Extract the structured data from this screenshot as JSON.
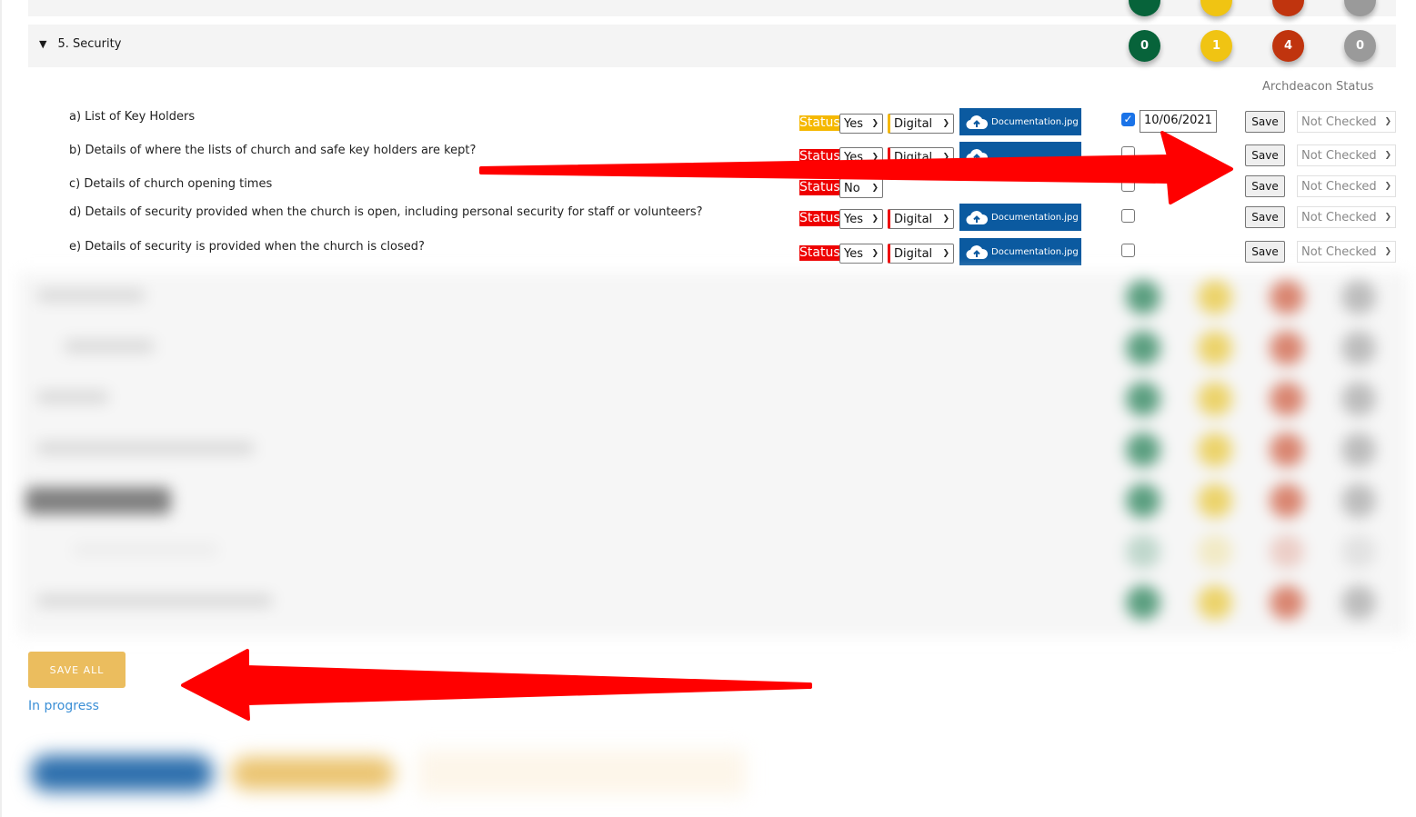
{
  "previous_section": {
    "badges": {
      "green": "",
      "yellow": "",
      "red": "",
      "grey": ""
    }
  },
  "section": {
    "caret": "▼",
    "title": "5. Security",
    "badges": {
      "green": "0",
      "yellow": "1",
      "red": "4",
      "grey": "0"
    },
    "archdeacon_header": "Archdeacon Status"
  },
  "colors": {
    "green": "#07633a",
    "yellow": "#f0c413",
    "red": "#c0340e",
    "grey": "#9a9a9a",
    "status_yellow": "#f5b800",
    "status_red": "#ee0000",
    "doc_blue": "#0b5aa0",
    "save_all": "#ebbd5e",
    "in_progress": "#3b8fd6",
    "annotation_arrow": "#ff0000"
  },
  "questions": [
    {
      "text": "a) List of Key Holders",
      "status_label": "Status",
      "status_color": "yellow",
      "answer": "Yes",
      "format": "Digital",
      "document": "Documentation.jpg",
      "checked": true,
      "date": "10/06/2021",
      "save_label": "Save",
      "archdeacon_status": "Not Checked"
    },
    {
      "text": "b) Details of where the lists of church and safe key holders are kept?",
      "status_label": "Status",
      "status_color": "red",
      "answer": "Yes",
      "format": "Digital",
      "document": "",
      "checked": false,
      "date": "",
      "save_label": "Save",
      "archdeacon_status": "Not Checked"
    },
    {
      "text": "c) Details of church opening times",
      "status_label": "Status",
      "status_color": "red",
      "answer": "No",
      "format": "",
      "document": "",
      "checked": false,
      "date": "",
      "save_label": "Save",
      "archdeacon_status": "Not Checked"
    },
    {
      "text": "d) Details of security provided when the church is open, including personal security for staff or volunteers?",
      "status_label": "Status",
      "status_color": "red",
      "answer": "Yes",
      "format": "Digital",
      "document": "Documentation.jpg",
      "checked": false,
      "date": "",
      "save_label": "Save",
      "archdeacon_status": "Not Checked"
    },
    {
      "text": "e) Details of security is provided when the church is closed?",
      "status_label": "Status",
      "status_color": "red",
      "answer": "Yes",
      "format": "Digital",
      "document": "Documentation.jpg",
      "checked": false,
      "date": "",
      "save_label": "Save",
      "archdeacon_status": "Not Checked"
    }
  ],
  "footer": {
    "save_all_label": "SAVE ALL",
    "status_text": "In progress"
  },
  "icons": {
    "caret": "caret-down-icon",
    "upload": "cloud-upload-icon",
    "chevron": "chevron-down-icon",
    "check": "checkmark-icon"
  }
}
